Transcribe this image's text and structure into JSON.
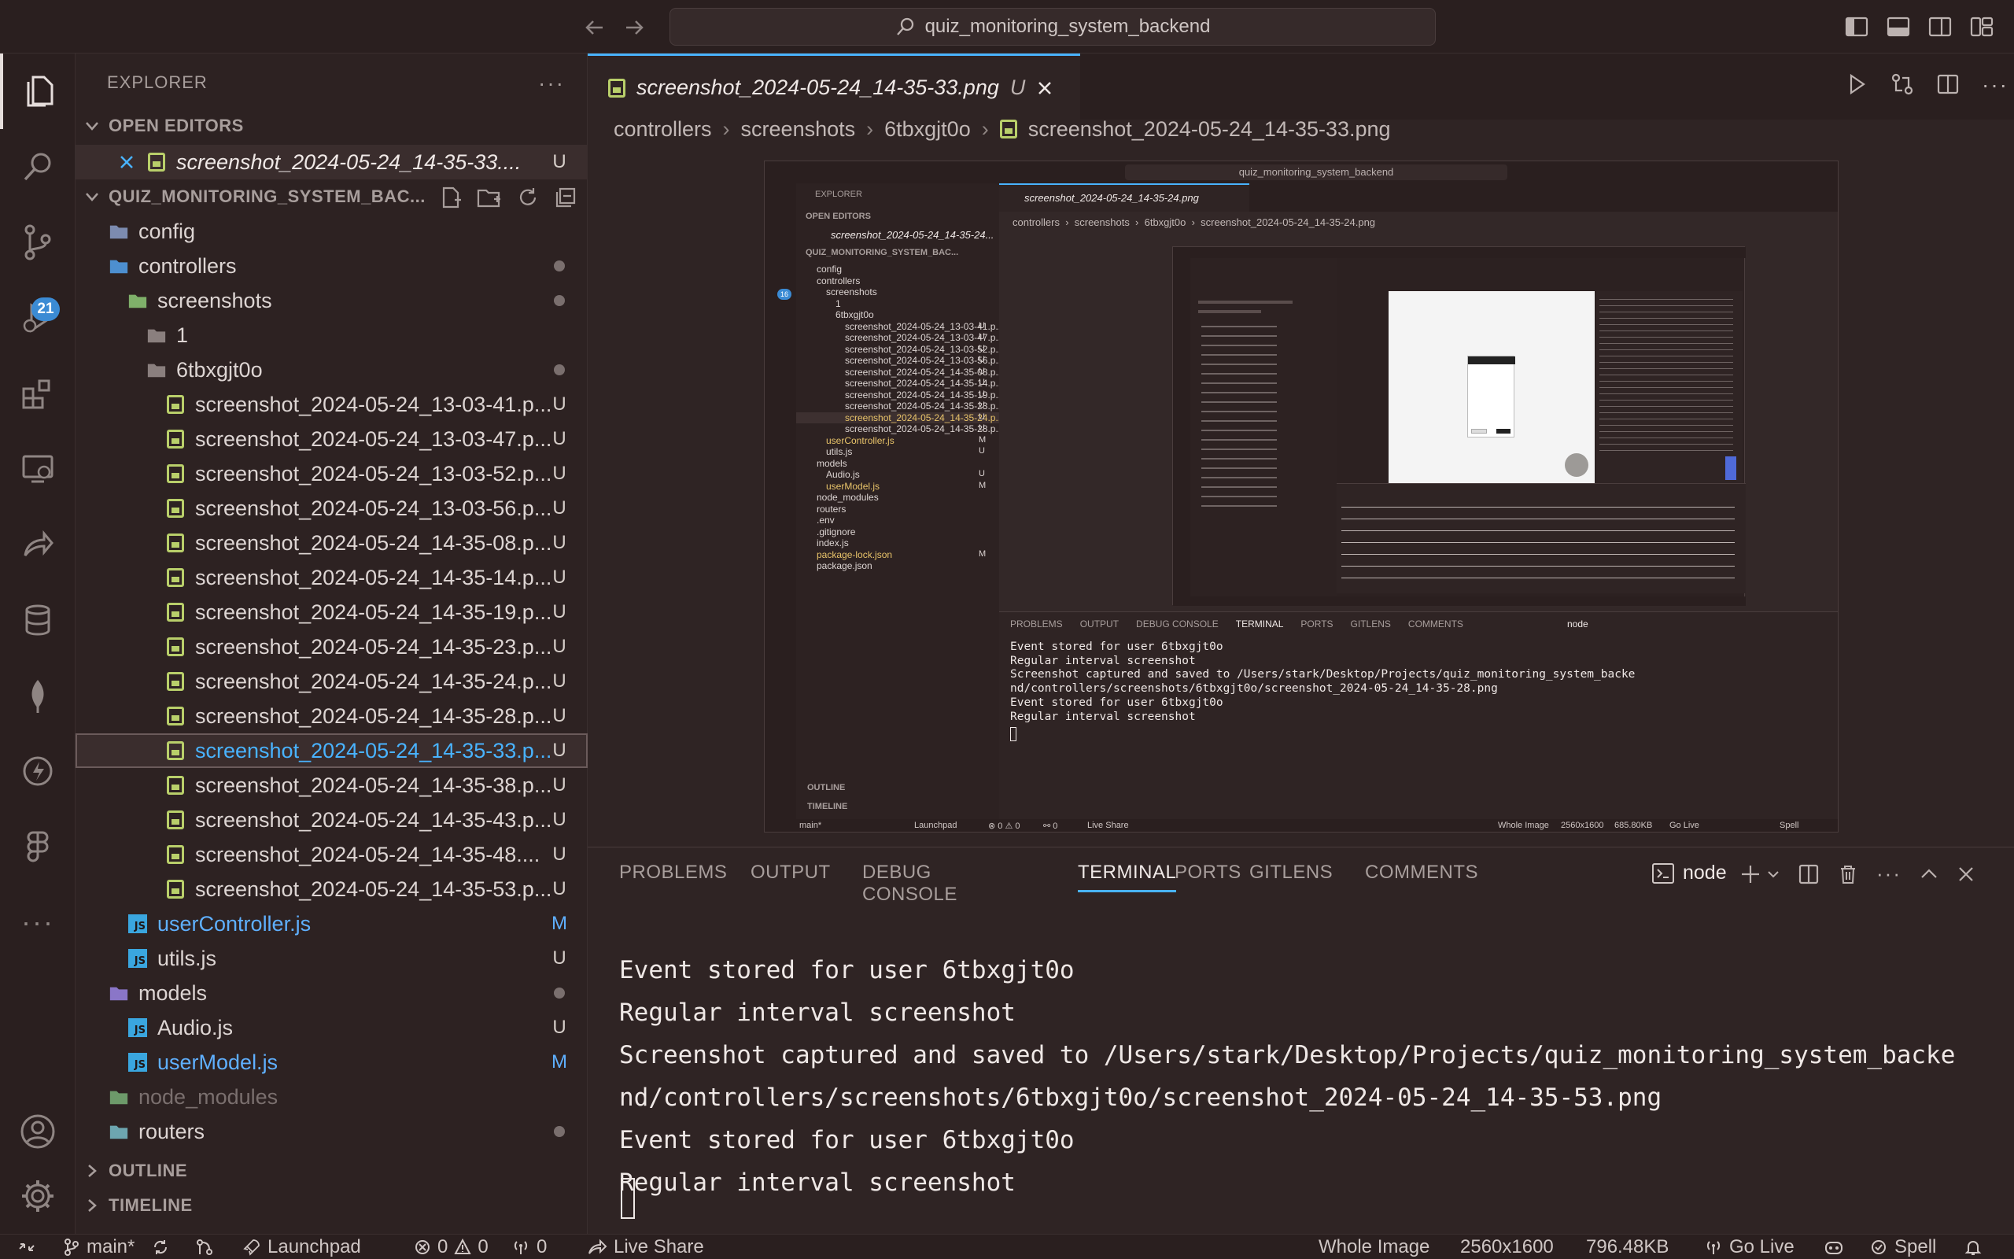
{
  "search": {
    "text": "quiz_monitoring_system_backend"
  },
  "activity": {
    "scm_badge": "21"
  },
  "sidebar": {
    "title": "EXPLORER",
    "open_editors_label": "OPEN EDITORS",
    "open_editor": {
      "name": "screenshot_2024-05-24_14-35-33....",
      "status": "U"
    },
    "project_label": "QUIZ_MONITORING_SYSTEM_BAC...",
    "outline_label": "OUTLINE",
    "timeline_label": "TIMELINE",
    "tree": [
      {
        "name": "config",
        "kind": "folder-config",
        "depth": 0,
        "status": ""
      },
      {
        "name": "controllers",
        "kind": "folder-controllers",
        "depth": 0,
        "status": "dot"
      },
      {
        "name": "screenshots",
        "kind": "folder-screenshots",
        "depth": 1,
        "status": "dot"
      },
      {
        "name": "1",
        "kind": "folder",
        "depth": 2,
        "status": ""
      },
      {
        "name": "6tbxgjt0o",
        "kind": "folder",
        "depth": 2,
        "status": "dot"
      },
      {
        "name": "screenshot_2024-05-24_13-03-41.p...",
        "kind": "png",
        "depth": 3,
        "status": "U"
      },
      {
        "name": "screenshot_2024-05-24_13-03-47.p...",
        "kind": "png",
        "depth": 3,
        "status": "U"
      },
      {
        "name": "screenshot_2024-05-24_13-03-52.p...",
        "kind": "png",
        "depth": 3,
        "status": "U"
      },
      {
        "name": "screenshot_2024-05-24_13-03-56.p...",
        "kind": "png",
        "depth": 3,
        "status": "U"
      },
      {
        "name": "screenshot_2024-05-24_14-35-08.p...",
        "kind": "png",
        "depth": 3,
        "status": "U"
      },
      {
        "name": "screenshot_2024-05-24_14-35-14.p...",
        "kind": "png",
        "depth": 3,
        "status": "U"
      },
      {
        "name": "screenshot_2024-05-24_14-35-19.p...",
        "kind": "png",
        "depth": 3,
        "status": "U"
      },
      {
        "name": "screenshot_2024-05-24_14-35-23.p...",
        "kind": "png",
        "depth": 3,
        "status": "U"
      },
      {
        "name": "screenshot_2024-05-24_14-35-24.p...",
        "kind": "png",
        "depth": 3,
        "status": "U"
      },
      {
        "name": "screenshot_2024-05-24_14-35-28.p...",
        "kind": "png",
        "depth": 3,
        "status": "U"
      },
      {
        "name": "screenshot_2024-05-24_14-35-33.p...",
        "kind": "png",
        "depth": 3,
        "status": "U",
        "selected": true
      },
      {
        "name": "screenshot_2024-05-24_14-35-38.p...",
        "kind": "png",
        "depth": 3,
        "status": "U"
      },
      {
        "name": "screenshot_2024-05-24_14-35-43.p...",
        "kind": "png",
        "depth": 3,
        "status": "U"
      },
      {
        "name": "screenshot_2024-05-24_14-35-48....",
        "kind": "png",
        "depth": 3,
        "status": "U"
      },
      {
        "name": "screenshot_2024-05-24_14-35-53.p...",
        "kind": "png",
        "depth": 3,
        "status": "U"
      },
      {
        "name": "userController.js",
        "kind": "js",
        "depth": 1,
        "status": "M"
      },
      {
        "name": "utils.js",
        "kind": "js",
        "depth": 1,
        "status": "U"
      },
      {
        "name": "models",
        "kind": "folder-models",
        "depth": 0,
        "status": "dot"
      },
      {
        "name": "Audio.js",
        "kind": "js",
        "depth": 1,
        "status": "U"
      },
      {
        "name": "userModel.js",
        "kind": "js",
        "depth": 1,
        "status": "M"
      },
      {
        "name": "node_modules",
        "kind": "folder-node",
        "depth": 0,
        "status": "",
        "dim": true
      },
      {
        "name": "routers",
        "kind": "folder-routers",
        "depth": 0,
        "status": "dot"
      }
    ]
  },
  "editor": {
    "tab": {
      "label": "screenshot_2024-05-24_14-35-33.png",
      "status": "U"
    },
    "breadcrumb": [
      "controllers",
      "screenshots",
      "6tbxgjt0o",
      "screenshot_2024-05-24_14-35-33.png"
    ]
  },
  "nested": {
    "search": "quiz_monitoring_system_backend",
    "explorer": "EXPLORER",
    "open_editors": "OPEN EDITORS",
    "open_editor": "screenshot_2024-05-24_14-35-24...",
    "project": "QUIZ_MONITORING_SYSTEM_BAC...",
    "tab": "screenshot_2024-05-24_14-35-24.png",
    "breadcrumb": "controllers  ›  screenshots  ›  6tbxgjt0o  ›  screenshot_2024-05-24_14-35-24.png",
    "scm_badge": "16",
    "tree": [
      {
        "name": "config",
        "depth": 0,
        "status": ""
      },
      {
        "name": "controllers",
        "depth": 0,
        "status": "dot"
      },
      {
        "name": "screenshots",
        "depth": 1,
        "status": "dot"
      },
      {
        "name": "1",
        "depth": 2,
        "status": ""
      },
      {
        "name": "6tbxgjt0o",
        "depth": 2,
        "status": "dot"
      },
      {
        "name": "screenshot_2024-05-24_13-03-41.p...",
        "depth": 3,
        "status": "U"
      },
      {
        "name": "screenshot_2024-05-24_13-03-47.p...",
        "depth": 3,
        "status": "U"
      },
      {
        "name": "screenshot_2024-05-24_13-03-52.p...",
        "depth": 3,
        "status": "U"
      },
      {
        "name": "screenshot_2024-05-24_13-03-56.p...",
        "depth": 3,
        "status": "U"
      },
      {
        "name": "screenshot_2024-05-24_14-35-08.p...",
        "depth": 3,
        "status": "U"
      },
      {
        "name": "screenshot_2024-05-24_14-35-14.p...",
        "depth": 3,
        "status": "U"
      },
      {
        "name": "screenshot_2024-05-24_14-35-19.p...",
        "depth": 3,
        "status": "U"
      },
      {
        "name": "screenshot_2024-05-24_14-35-23.p...",
        "depth": 3,
        "status": "U"
      },
      {
        "name": "screenshot_2024-05-24_14-35-24.p...",
        "depth": 3,
        "status": "U",
        "selected": true
      },
      {
        "name": "screenshot_2024-05-24_14-35-28.p...",
        "depth": 3,
        "status": "U"
      },
      {
        "name": "userController.js",
        "depth": 1,
        "status": "M"
      },
      {
        "name": "utils.js",
        "depth": 1,
        "status": "U"
      },
      {
        "name": "models",
        "depth": 0,
        "status": ""
      },
      {
        "name": "Audio.js",
        "depth": 1,
        "status": "U"
      },
      {
        "name": "userModel.js",
        "depth": 1,
        "status": "M"
      },
      {
        "name": "node_modules",
        "depth": 0,
        "status": ""
      },
      {
        "name": "routers",
        "depth": 0,
        "status": "dot"
      },
      {
        "name": ".env",
        "depth": 0,
        "status": ""
      },
      {
        "name": ".gitignore",
        "depth": 0,
        "status": ""
      },
      {
        "name": "index.js",
        "depth": 0,
        "status": ""
      },
      {
        "name": "package-lock.json",
        "depth": 0,
        "status": "M"
      },
      {
        "name": "package.json",
        "depth": 0,
        "status": ""
      }
    ],
    "outline": "OUTLINE",
    "timeline": "TIMELINE",
    "panel_tabs": [
      "PROBLEMS",
      "OUTPUT",
      "DEBUG CONSOLE",
      "TERMINAL",
      "PORTS",
      "GITLENS",
      "COMMENTS"
    ],
    "panel_node": "node",
    "terminal": [
      "Event stored for user 6tbxgjt0o",
      "Regular interval screenshot",
      "Screenshot captured and saved to /Users/stark/Desktop/Projects/quiz_monitoring_system_backe",
      "nd/controllers/screenshots/6tbxgjt0o/screenshot_2024-05-24_14-35-28.png",
      "Event stored for user 6tbxgjt0o",
      "Regular interval screenshot"
    ],
    "status": {
      "branch": "main*",
      "launchpad": "Launchpad",
      "errors": "0",
      "warnings": "0",
      "ports": "0",
      "liveshare": "Live Share",
      "whole_image": "Whole Image",
      "dims": "2560x1600",
      "size": "685.80KB",
      "golive": "Go Live",
      "spell": "Spell"
    }
  },
  "panel": {
    "tabs": [
      "PROBLEMS",
      "OUTPUT",
      "DEBUG CONSOLE",
      "TERMINAL",
      "PORTS",
      "GITLENS",
      "COMMENTS"
    ],
    "active_tab": "TERMINAL",
    "terminal_name": "node",
    "terminal_lines": [
      "Event stored for user 6tbxgjt0o",
      "Regular interval screenshot",
      "Screenshot captured and saved to /Users/stark/Desktop/Projects/quiz_monitoring_system_backe",
      "nd/controllers/screenshots/6tbxgjt0o/screenshot_2024-05-24_14-35-53.png",
      "Event stored for user 6tbxgjt0o",
      "Regular interval screenshot"
    ]
  },
  "status": {
    "branch": "main*",
    "launchpad": "Launchpad",
    "errors": "0",
    "warnings": "0",
    "ports": "0",
    "liveshare": "Live Share",
    "whole_image": "Whole Image",
    "dims": "2560x1600",
    "size": "796.48KB",
    "golive": "Go Live",
    "spell": "Spell"
  },
  "colors": {
    "accent": "#49b3ff",
    "png_icon": "#b9cf6a",
    "js_icon": "#3aa6df",
    "modified": "#5fb0ff"
  }
}
